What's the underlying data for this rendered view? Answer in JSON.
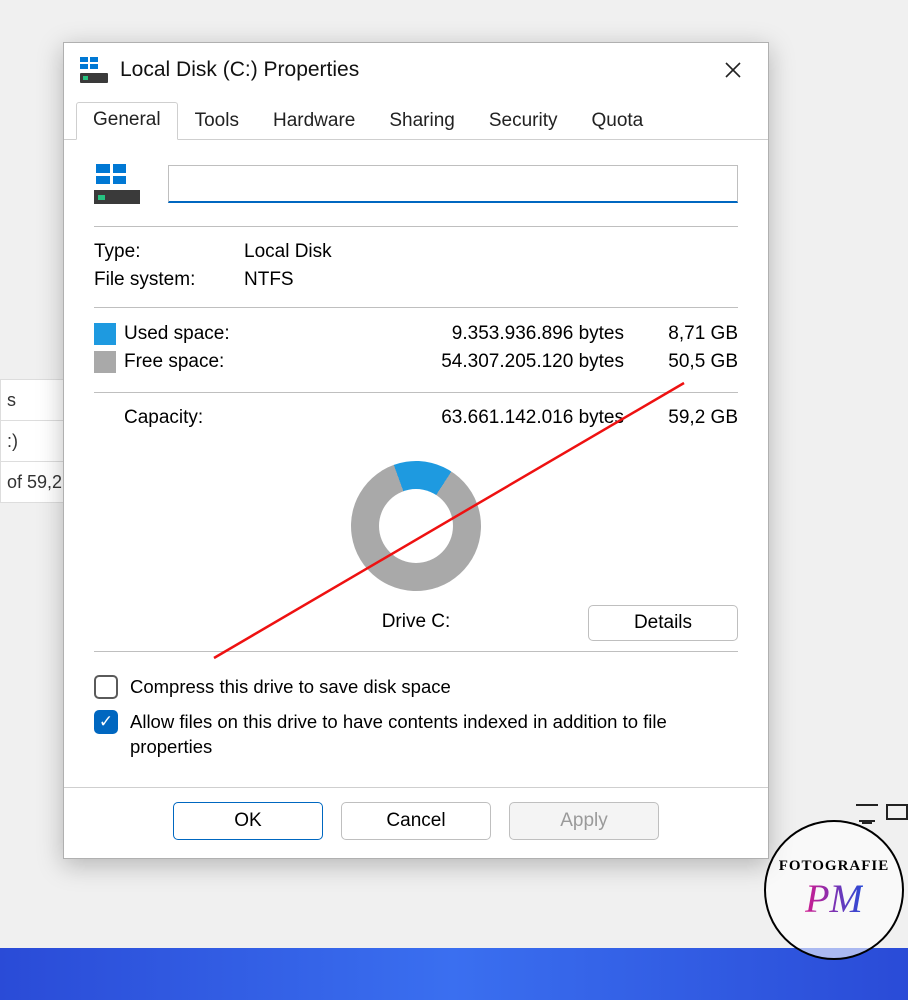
{
  "window": {
    "title": "Local Disk (C:) Properties"
  },
  "tabs": {
    "general": "General",
    "tools": "Tools",
    "hardware": "Hardware",
    "sharing": "Sharing",
    "security": "Security",
    "quota": "Quota"
  },
  "name_field": {
    "value": ""
  },
  "info": {
    "type_label": "Type:",
    "type_value": "Local Disk",
    "fs_label": "File system:",
    "fs_value": "NTFS"
  },
  "space": {
    "used_label": "Used space:",
    "used_bytes": "9.353.936.896 bytes",
    "used_gb": "8,71 GB",
    "free_label": "Free space:",
    "free_bytes": "54.307.205.120 bytes",
    "free_gb": "50,5 GB",
    "cap_label": "Capacity:",
    "cap_bytes": "63.661.142.016 bytes",
    "cap_gb": "59,2 GB"
  },
  "drive_label": "Drive C:",
  "details_btn": "Details",
  "checks": {
    "compress": "Compress this drive to save disk space",
    "index": "Allow files on this drive to have contents indexed in addition to file properties"
  },
  "buttons": {
    "ok": "OK",
    "cancel": "Cancel",
    "apply": "Apply"
  },
  "background": {
    "row1": "s",
    "row2": ":)",
    "row3": "of 59,2"
  },
  "watermark": {
    "line1": "FOTOGRAFIE",
    "line2": "PM"
  },
  "chart_data": {
    "type": "pie",
    "title": "Drive C: space usage",
    "series": [
      {
        "name": "Used space",
        "value_bytes": 9353936896,
        "value_gb": 8.71,
        "color": "#1e9ae0"
      },
      {
        "name": "Free space",
        "value_bytes": 54307205120,
        "value_gb": 50.5,
        "color": "#a9a9a9"
      }
    ],
    "total_bytes": 63661142016,
    "total_gb": 59.2
  }
}
